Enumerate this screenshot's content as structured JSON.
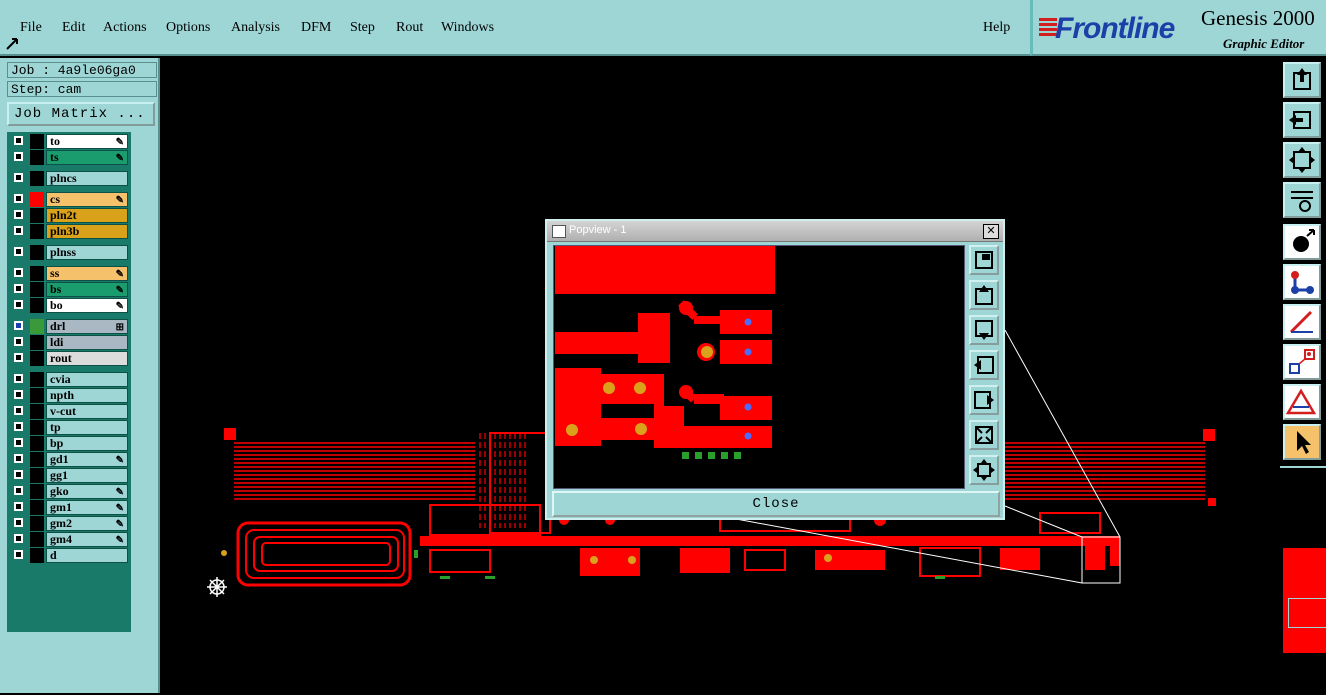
{
  "menubar": {
    "items": [
      "File",
      "Edit",
      "Actions",
      "Options",
      "Analysis",
      "DFM",
      "Step",
      "Rout",
      "Windows"
    ],
    "help": "Help"
  },
  "brand": {
    "logo": "Frontline",
    "title": "Genesis 2000",
    "subtitle": "Graphic Editor"
  },
  "job": {
    "job_line": "Job : 4a9le06ga0",
    "step_line": "Step: cam",
    "matrix_button": "Job Matrix ..."
  },
  "layers": [
    {
      "name": "to",
      "color": "#ffffff",
      "swatch": "#000000",
      "mark": "✎"
    },
    {
      "name": "ts",
      "color": "#1a9c6e",
      "swatch": "#000000",
      "mark": "✎"
    },
    {
      "name": "plncs",
      "color": "#9ed6d6",
      "swatch": "#000000",
      "mark": ""
    },
    {
      "name": "cs",
      "color": "#f5c26b",
      "swatch": "#ff0000",
      "mark": "✎"
    },
    {
      "name": "pln2t",
      "color": "#d9a21a",
      "swatch": "#000000",
      "mark": ""
    },
    {
      "name": "pln3b",
      "color": "#d9a21a",
      "swatch": "#000000",
      "mark": ""
    },
    {
      "name": "plnss",
      "color": "#9ed6d6",
      "swatch": "#000000",
      "mark": ""
    },
    {
      "name": "ss",
      "color": "#f5c26b",
      "swatch": "#000000",
      "mark": "✎"
    },
    {
      "name": "bs",
      "color": "#1a9c6e",
      "swatch": "#000000",
      "mark": "✎"
    },
    {
      "name": "bo",
      "color": "#ffffff",
      "swatch": "#000000",
      "mark": "✎"
    },
    {
      "name": "drl",
      "color": "#a9b8c2",
      "swatch": "#3a9a3a",
      "mark": "⊞"
    },
    {
      "name": "ldi",
      "color": "#a9b8c2",
      "swatch": "#000000",
      "mark": ""
    },
    {
      "name": "rout",
      "color": "#dcdcdc",
      "swatch": "#000000",
      "mark": ""
    },
    {
      "name": "cvia",
      "color": "#9ed6d6",
      "swatch": "#000000",
      "mark": ""
    },
    {
      "name": "npth",
      "color": "#9ed6d6",
      "swatch": "#000000",
      "mark": ""
    },
    {
      "name": "v-cut",
      "color": "#9ed6d6",
      "swatch": "#000000",
      "mark": ""
    },
    {
      "name": "tp",
      "color": "#9ed6d6",
      "swatch": "#000000",
      "mark": ""
    },
    {
      "name": "bp",
      "color": "#9ed6d6",
      "swatch": "#000000",
      "mark": ""
    },
    {
      "name": "gd1",
      "color": "#9ed6d6",
      "swatch": "#000000",
      "mark": "✎"
    },
    {
      "name": "gg1",
      "color": "#9ed6d6",
      "swatch": "#000000",
      "mark": ""
    },
    {
      "name": "gko",
      "color": "#9ed6d6",
      "swatch": "#000000",
      "mark": "✎"
    },
    {
      "name": "gm1",
      "color": "#9ed6d6",
      "swatch": "#000000",
      "mark": "✎"
    },
    {
      "name": "gm2",
      "color": "#9ed6d6",
      "swatch": "#000000",
      "mark": "✎"
    },
    {
      "name": "gm4",
      "color": "#9ed6d6",
      "swatch": "#000000",
      "mark": "✎"
    },
    {
      "name": "d",
      "color": "#9ed6d6",
      "swatch": "#000000",
      "mark": ""
    }
  ],
  "popview": {
    "title": "Popview - 1",
    "close_label": "Close",
    "close_x": "✕"
  },
  "colors": {
    "panel": "#9ed6d6",
    "copper": "#ff0000",
    "background": "#000000"
  }
}
